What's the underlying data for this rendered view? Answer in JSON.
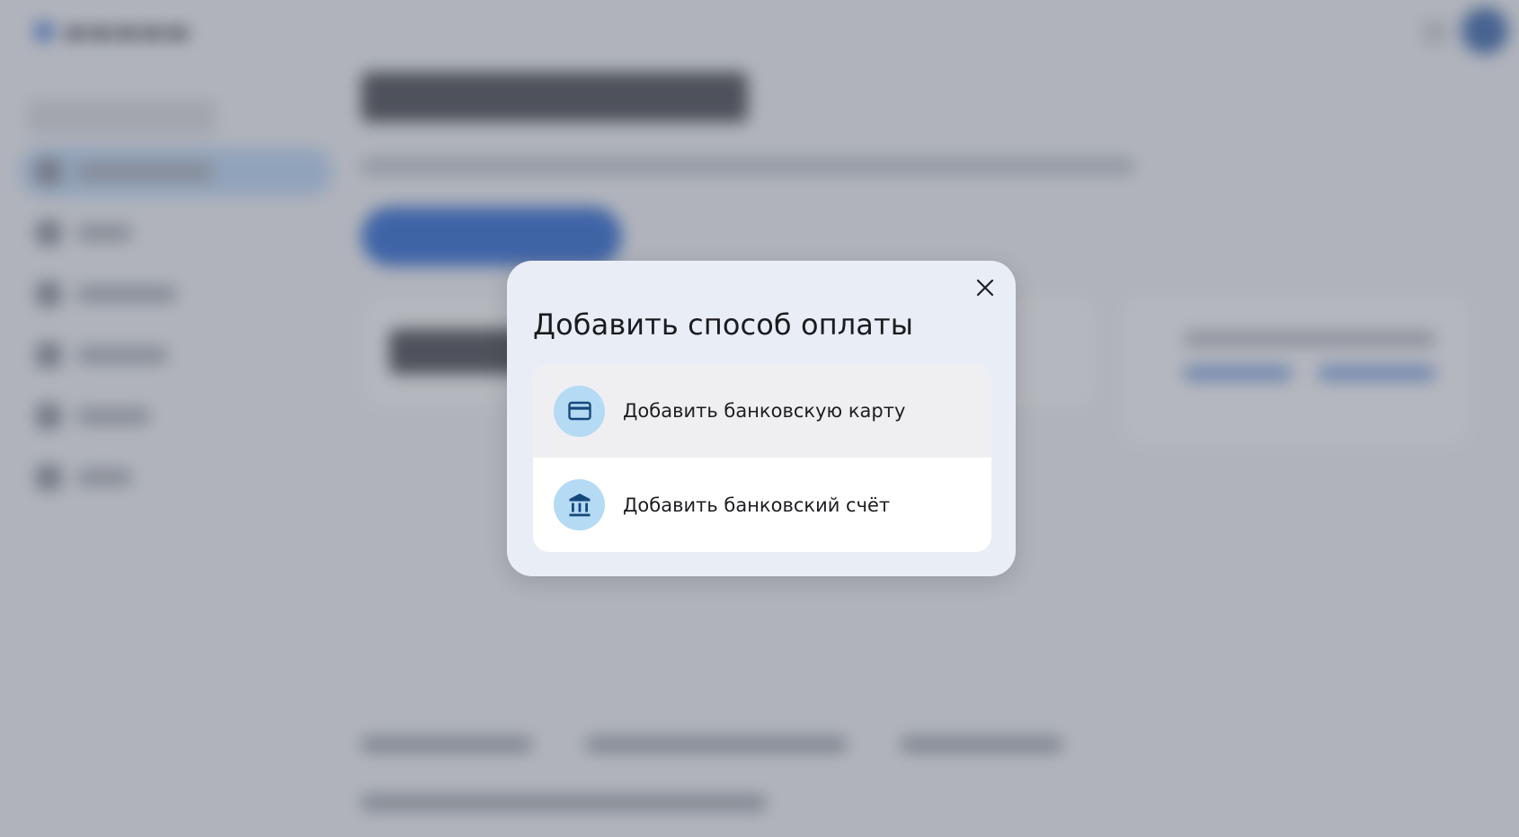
{
  "dialog": {
    "title": "Добавить способ оплаты",
    "close_icon": "close-icon",
    "options": [
      {
        "label": "Добавить банковскую карту",
        "icon": "credit-card-icon",
        "state": "hovered"
      },
      {
        "label": "Добавить банковский счёт",
        "icon": "bank-icon",
        "state": "default"
      }
    ]
  },
  "colors": {
    "dialog_background": "#e9edf6",
    "icon_circle": "#b5daf4",
    "icon_glyph": "#16487c",
    "hover_row": "#efeff1",
    "scrim": "#666b76"
  }
}
